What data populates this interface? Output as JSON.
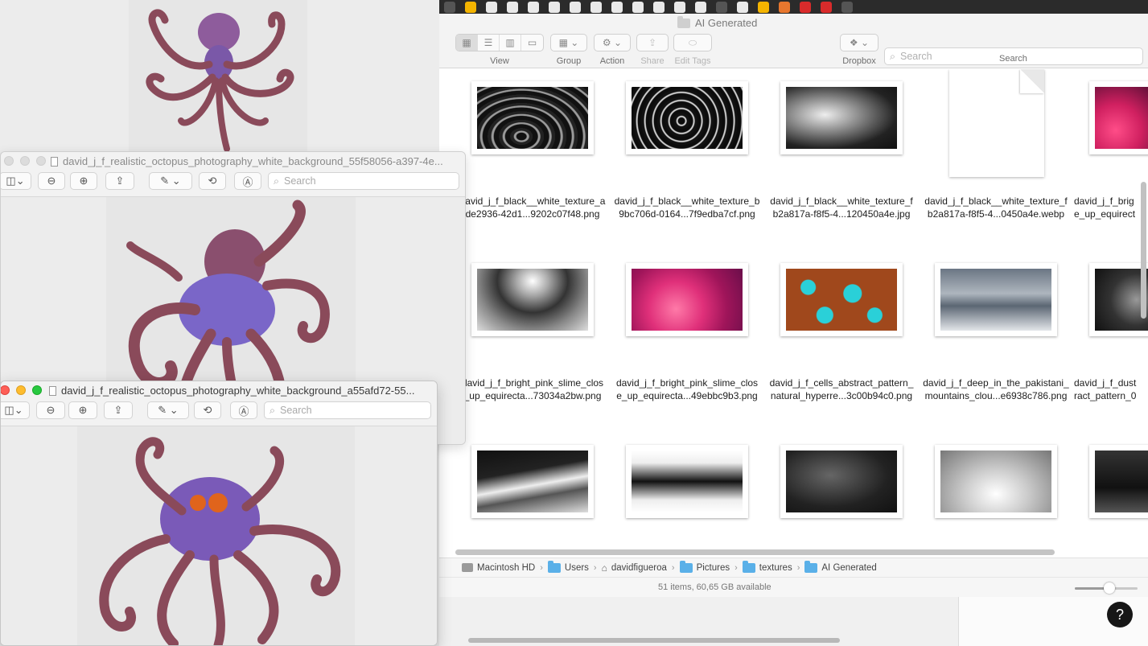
{
  "finder": {
    "title": "AI Generated",
    "toolbar": {
      "view_label": "View",
      "group_label": "Group",
      "action_label": "Action",
      "share_label": "Share",
      "edit_tags_label": "Edit Tags",
      "dropbox_label": "Dropbox",
      "search_label": "Search",
      "search_placeholder": "Search"
    },
    "files": [
      {
        "line1": "david_j_f_black__white_texture_a",
        "line2": "de2936-42d1...9202c07f48.png",
        "thumb": "texture-wavy"
      },
      {
        "line1": "david_j_f_black__white_texture_b",
        "line2": "9bc706d-0164...7f9edba7cf.png",
        "thumb": "texture-swirl"
      },
      {
        "line1": "david_j_f_black__white_texture_f",
        "line2": "b2a817a-f8f5-4...120450a4e.jpg",
        "thumb": "texture-rough"
      },
      {
        "line1": "david_j_f_black__white_texture_f",
        "line2": "b2a817a-f8f5-4...0450a4e.webp",
        "thumb": "document"
      },
      {
        "line1": "david_j_f_brig",
        "line2": "e_up_equirect",
        "thumb": "pink-slime"
      },
      {
        "line1": "david_j_f_bright_pink_slime_clos",
        "line2": "_up_equirecta...73034a2bw.png",
        "thumb": "bw-slime"
      },
      {
        "line1": "david_j_f_bright_pink_slime_clos",
        "line2": "e_up_equirecta...49ebbc9b3.png",
        "thumb": "pink-slime"
      },
      {
        "line1": "david_j_f_cells_abstract_pattern_",
        "line2": "natural_hyperre...3c00b94c0.png",
        "thumb": "cells"
      },
      {
        "line1": "david_j_f_deep_in_the_pakistani_",
        "line2": "mountains_clou...e6938c786.png",
        "thumb": "mountains"
      },
      {
        "line1": "david_j_f_dust",
        "line2": "ract_pattern_0",
        "thumb": "dust"
      },
      {
        "line1": "",
        "line2": "",
        "thumb": "smoke-wave"
      },
      {
        "line1": "",
        "line2": "",
        "thumb": "smoke-band"
      },
      {
        "line1": "",
        "line2": "",
        "thumb": "dark-cloud"
      },
      {
        "line1": "",
        "line2": "",
        "thumb": "mist"
      },
      {
        "line1": "",
        "line2": "",
        "thumb": "dark-sea"
      }
    ],
    "path": [
      "Macintosh HD",
      "Users",
      "davidfigueroa",
      "Pictures",
      "textures",
      "AI Generated"
    ],
    "status": "51 items, 60,65 GB available",
    "zoom_level": 0.55,
    "help": "?"
  },
  "preview_windows": [
    {
      "title": "david_j_f_realistic_octopus_photography_white_background_55f58056-a397-4e...",
      "search_placeholder": "Search",
      "active": false
    },
    {
      "title": "david_j_f_realistic_octopus_photography_white_background_a55afd72-55...",
      "search_placeholder": "Search",
      "active": true
    }
  ],
  "colors": {
    "octopus_body": "#7a5ab8",
    "octopus_tentacle": "#8a4a5a",
    "accent_blue": "#5ab0e8"
  }
}
